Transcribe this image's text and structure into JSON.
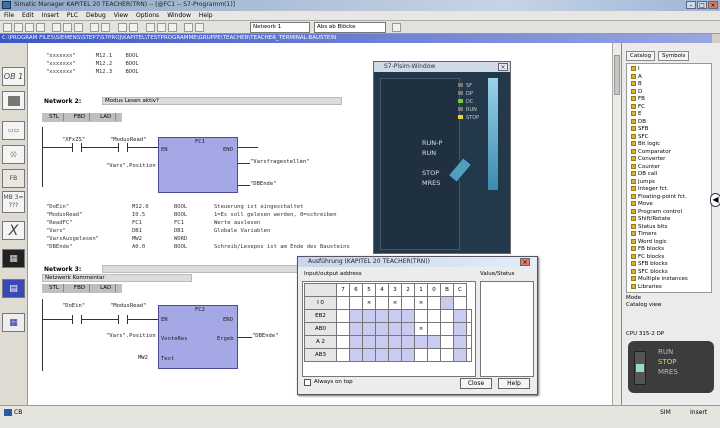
{
  "window": {
    "title": "Simatic Manager KAPITEL 20 TEACHER(TRN) -- [@FC1 -- S7-Programm(1)]",
    "icon": "app-icon"
  },
  "menu": [
    "File",
    "Edit",
    "Insert",
    "PLC",
    "Debug",
    "View",
    "Options",
    "Window",
    "Help"
  ],
  "toolbar": {
    "view_combo": "Network 1",
    "search_combo": "Abs ab Blöcke"
  },
  "path_bar": "C:\\PROGRAM FILES\\SIEMENS\\STEP7\\S7PROJ\\KAPITEL\\TESTPROGRAMME\\GRUPPE\\TEACHER\\TEACHER_TERMINAL-BAUSTEIN",
  "leftbar": [
    "OB 1",
    "",
    "",
    "",
    "FB",
    "MB 3=",
    "X",
    "",
    ""
  ],
  "editor": {
    "top_rows": [
      {
        "addr": "\"xxxxxxx\"",
        "type": "M12.1",
        "dt": "BOOL"
      },
      {
        "addr": "\"xxxxxxx\"",
        "type": "M12.2",
        "dt": "BOOL"
      },
      {
        "addr": "\"xxxxxxx\"",
        "type": "M12.3",
        "dt": "BOOL"
      }
    ],
    "network2": {
      "title": "Network 2:",
      "comment": "Modus Lesen aktiv?",
      "tabs": [
        "STL",
        "FBD",
        "LAD"
      ],
      "fb_name": "FC1",
      "contacts": [
        "\"XFxZS\"",
        "\"ModusRead\""
      ],
      "param_in": [
        "EN",
        "\"Vars\".Position",
        "ENO"
      ],
      "param_out": [
        "ENO",
        "\"Varsfragestellen\"",
        "\"DBEnde\""
      ],
      "symbol_rows": [
        {
          "name": "\"DoEin\"",
          "addr": "M12.0",
          "type": "BOOL",
          "comment": "Steuerung ist eingeschaltet"
        },
        {
          "name": "\"ModusRead\"",
          "addr": "I0.5",
          "type": "BOOL",
          "comment": "1=Es soll gelesen werden, 0=schreiben"
        },
        {
          "name": "\"ReadFC\"",
          "addr": "FC1",
          "type": "FC1",
          "comment": "Werte auslesen"
        },
        {
          "name": "\"Vars\"",
          "addr": "DB1",
          "type": "DB1",
          "comment": "Globale Variablen"
        },
        {
          "name": "\"VarsAusgelesen\"",
          "addr": "MW2",
          "type": "WORD",
          "comment": ""
        },
        {
          "name": "\"DBEnde\"",
          "addr": "A0.0",
          "type": "BOOL",
          "comment": "Schreib/Lesepos ist am Ende des Bausteins"
        }
      ]
    },
    "network3": {
      "title": "Network 3:",
      "comment": "Netzwerk Kommentar",
      "tabs": [
        "STL",
        "FBD",
        "LAD"
      ],
      "fb_name": "FC2",
      "contacts": [
        "\"DoEin\"",
        "\"ModusRead\""
      ],
      "param_in": [
        "EN",
        "VonteRes",
        "Text"
      ],
      "param_out": [
        "ENO",
        "Ergeb"
      ],
      "input_labels": [
        "\"Vars\".Position",
        "MW2"
      ],
      "output_label": "\"DBEnde\""
    }
  },
  "sim_window": {
    "title": "S7-Plsim-Window",
    "leds": [
      "SF",
      "DP",
      "DC",
      "RUN",
      "STOP"
    ],
    "mode_labels": [
      "RUN-P",
      "RUN",
      "STOP",
      "MRES"
    ]
  },
  "watch_window": {
    "title": "Ausführung (KAPITEL 20 TEACHER(TRN))",
    "subtitle": "Input/output address",
    "right_title": "Value/Status",
    "header_bits": [
      "7",
      "6",
      "5",
      "4",
      "3",
      "2",
      "1",
      "0",
      "B",
      "C"
    ],
    "rows": [
      "I 0",
      "EB2",
      "AB0",
      "A 2",
      "AB3"
    ],
    "checkbox_label": "Always on top",
    "buttons": [
      "Close",
      "Help"
    ]
  },
  "right_panel": {
    "tabs": [
      "Catalog",
      "Symbols"
    ],
    "tree": [
      "I",
      "A",
      "B",
      "D",
      "FB",
      "FC",
      "E",
      "DB",
      "SFB",
      "SFC",
      "Bit logic",
      "Comparator",
      "Converter",
      "Counter",
      "DB call",
      "Jumps",
      "Integer fct.",
      "Floating-point fct.",
      "Move",
      "Program control",
      "Shift/Rotate",
      "Status bits",
      "Timers",
      "Word logic",
      "FB blocks",
      "FC blocks",
      "SFB blocks",
      "SFC blocks",
      "Multiple instances",
      "Libraries"
    ],
    "footer1": "Mode",
    "footer2": "Catalog view",
    "plc_title": "CPU 315-2 DP",
    "plc_labels": [
      "RUN",
      "STOP",
      "MRES"
    ]
  },
  "status": {
    "left": "CB",
    "right1": "SIM",
    "right2": "Insert"
  }
}
